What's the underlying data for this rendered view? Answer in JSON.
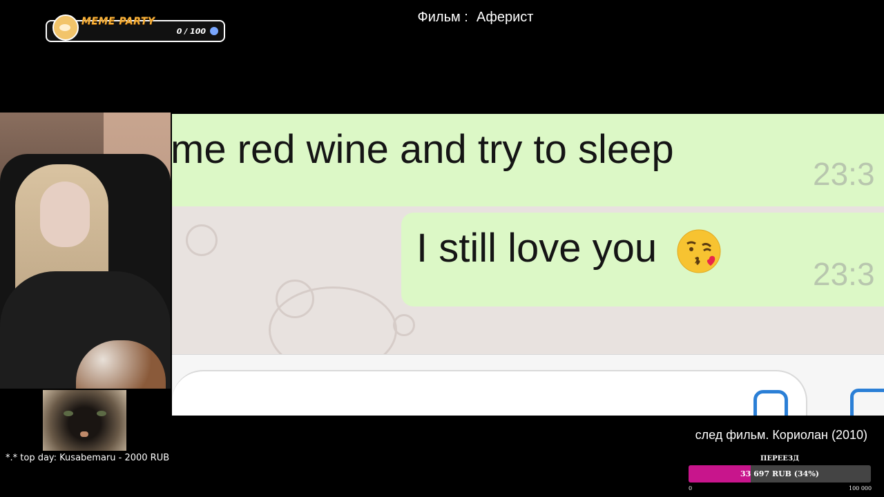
{
  "meme_widget": {
    "title": "MEME PARTY",
    "count": "0 / 100"
  },
  "film": {
    "label": "Фильм :",
    "name": "Аферист"
  },
  "movie": {
    "message1": "me red wine and try to sleep",
    "time1": "23:3",
    "message2": "I still love you",
    "emoji": "kiss-emoji",
    "time2": "23:3"
  },
  "top_day": "*.* top day: Kusabemaru - 2000 RUB",
  "next_film": "след фильм. Кориолан (2010)",
  "goal": {
    "title": "ПЕРЕЕЗД",
    "progress_text": "33 697 RUB (34%)",
    "progress": 0.34,
    "min": "0",
    "max": "100 000",
    "fill_color": "#c8158c"
  }
}
